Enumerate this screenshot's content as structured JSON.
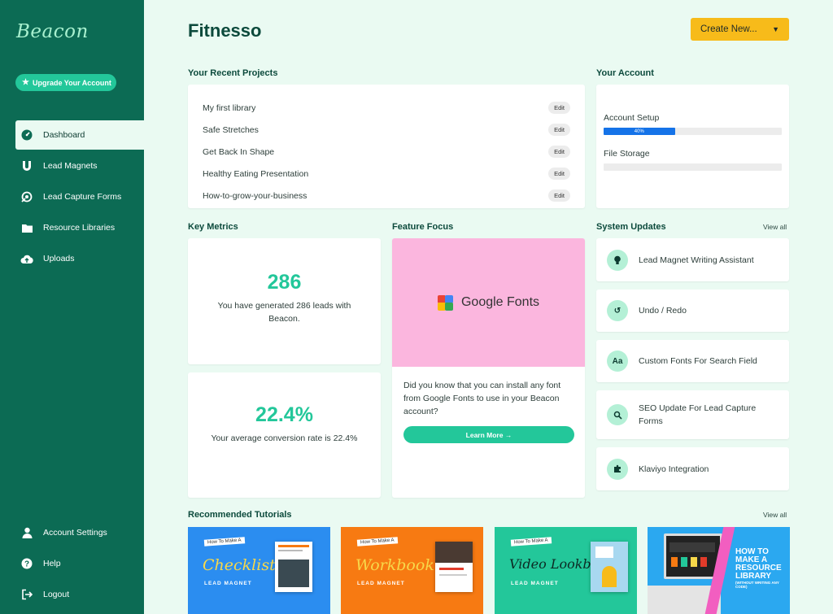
{
  "app": {
    "logo": "Beacon",
    "upgrade_label": "Upgrade Your Account",
    "page_title": "Fitnesso",
    "create_label": "Create New..."
  },
  "nav": {
    "items": [
      {
        "label": "Dashboard",
        "icon": "dashboard-gauge-icon"
      },
      {
        "label": "Lead Magnets",
        "icon": "magnet-icon"
      },
      {
        "label": "Lead Capture Forms",
        "icon": "form-target-icon"
      },
      {
        "label": "Resource Libraries",
        "icon": "folder-icon"
      },
      {
        "label": "Uploads",
        "icon": "cloud-upload-icon"
      }
    ],
    "bottom": [
      {
        "label": "Account Settings",
        "icon": "user-icon"
      },
      {
        "label": "Help",
        "icon": "help-icon"
      },
      {
        "label": "Logout",
        "icon": "logout-icon"
      }
    ]
  },
  "recent_projects": {
    "title": "Your Recent Projects",
    "edit_label": "Edit",
    "items": [
      "My first library",
      "Safe Stretches",
      "Get Back In Shape",
      "Healthy Eating Presentation",
      "How-to-grow-your-business"
    ]
  },
  "account": {
    "title": "Your Account",
    "setup_label": "Account Setup",
    "setup_progress": "40%",
    "setup_fraction": 0.4,
    "storage_label": "File Storage",
    "storage_fraction": 0
  },
  "metrics": {
    "title": "Key Metrics",
    "leads_value": "286",
    "leads_text": "You have generated 286 leads with Beacon.",
    "conversion_value": "22.4%",
    "conversion_text": "Your average conversion rate is 22.4%"
  },
  "feature": {
    "title": "Feature Focus",
    "brand": "Google Fonts",
    "text": "Did you know that you can install any font from Google Fonts to use in your Beacon account?",
    "button": "Learn More →"
  },
  "updates": {
    "title": "System Updates",
    "view_all": "View all",
    "items": [
      {
        "label": "Lead Magnet Writing Assistant",
        "icon": "lightbulb-icon"
      },
      {
        "label": "Undo / Redo",
        "icon": "undo-icon"
      },
      {
        "label": "Custom Fonts For Search Field",
        "icon": "font-icon"
      },
      {
        "label": "SEO Update For Lead Capture Forms",
        "icon": "search-icon"
      },
      {
        "label": "Klaviyo Integration",
        "icon": "puzzle-icon"
      }
    ]
  },
  "tutorials": {
    "title": "Recommended Tutorials",
    "view_all": "View all",
    "items": [
      {
        "small": "How To Make A",
        "big": "Checklist",
        "sub": "LEAD MAGNET",
        "bg": "#2b8df0",
        "fg": "#f7d84a"
      },
      {
        "small": "How To Make A",
        "big": "Workbook",
        "sub": "LEAD MAGNET",
        "bg": "#f77a12",
        "fg": "#f7d84a"
      },
      {
        "small": "How To Make A",
        "big": "Video Lookbook",
        "sub": "LEAD MAGNET",
        "bg": "#23c79a",
        "fg": "#0c2a24"
      },
      {
        "title": "HOW TO MAKE A RESOURCE LIBRARY",
        "sub": "(WITHOUT WRITING ANY CODE)",
        "bg": "#2ba8f0"
      }
    ]
  }
}
